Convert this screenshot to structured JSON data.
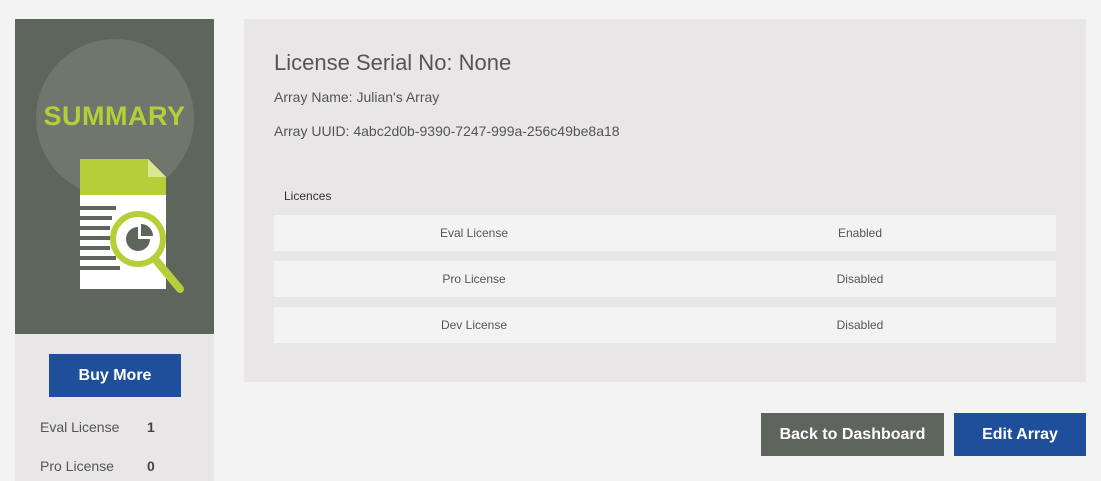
{
  "sidebar": {
    "summary_title": "SUMMARY",
    "buy_more_label": "Buy More",
    "counts": [
      {
        "label": "Eval License",
        "value": "1"
      },
      {
        "label": "Pro License",
        "value": "0"
      }
    ]
  },
  "main": {
    "serial": "License Serial No: None",
    "array_name": "Array Name: Julian's Array",
    "array_uuid": "Array UUID: 4abc2d0b-9390-7247-999a-256c49be8a18",
    "licences_heading": "Licences",
    "licences": [
      {
        "name": "Eval License",
        "status": "Enabled"
      },
      {
        "name": "Pro License",
        "status": "Disabled"
      },
      {
        "name": "Dev License",
        "status": "Disabled"
      }
    ]
  },
  "actions": {
    "back_label": "Back to Dashboard",
    "edit_label": "Edit Array"
  },
  "colors": {
    "accent_blue": "#1f4e9b",
    "summary_green": "#b5ce3a",
    "panel_dark": "#5d655c"
  },
  "icons": {
    "summary": "document-magnifier-icon"
  }
}
